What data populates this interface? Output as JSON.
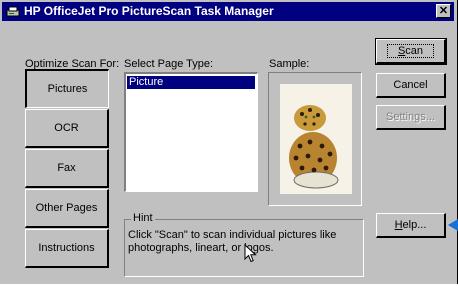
{
  "window": {
    "title": "HP OfficeJet Pro PictureScan Task Manager",
    "close_label": "✕"
  },
  "labels": {
    "optimize": "Optimize Scan For:",
    "page_type": "Select Page Type:",
    "sample": "Sample:"
  },
  "optimize_options": [
    {
      "label": "Pictures",
      "selected": true
    },
    {
      "label": "OCR",
      "selected": false
    },
    {
      "label": "Fax",
      "selected": false
    },
    {
      "label": "Other Pages",
      "selected": false
    },
    {
      "label": "Instructions",
      "selected": false
    }
  ],
  "page_types": [
    "Picture"
  ],
  "hint": {
    "legend": "Hint",
    "text": "Click \"Scan\" to scan individual pictures like photographs, lineart, or logos."
  },
  "buttons": {
    "scan_first": "S",
    "scan_rest": "can",
    "cancel": "Cancel",
    "settings": "Settings...",
    "help_first": "H",
    "help_rest": "elp..."
  },
  "colors": {
    "titlebar": "#000080",
    "face": "#c0c0c0",
    "selection": "#000080",
    "pointer_arrow": "#1a6fd8"
  }
}
